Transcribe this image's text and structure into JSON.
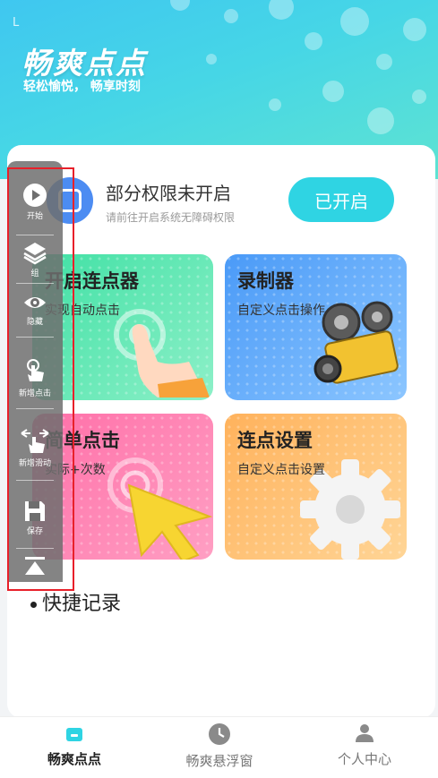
{
  "header": {
    "status_letter": "L",
    "app_title": "畅爽点点",
    "app_subtitle": "轻松愉悦， 畅享时刻"
  },
  "permission": {
    "title": "部分权限未开启",
    "subtitle": "请前往开启系统无障碍权限",
    "button_label": "已开启"
  },
  "features": [
    {
      "title": "开启连点器",
      "subtitle": "实现自动点击"
    },
    {
      "title": "录制器",
      "subtitle": "自定义点击操作"
    },
    {
      "title": "简单点击",
      "subtitle": "实际+次数"
    },
    {
      "title": "连点设置",
      "subtitle": "自定义点击设置"
    }
  ],
  "quick_record_label": "快捷记录",
  "float_panel": {
    "items": [
      {
        "label": "开始",
        "icon": "play-icon"
      },
      {
        "label": "组",
        "icon": "layers-icon"
      },
      {
        "label": "隐藏",
        "icon": "eye-icon"
      },
      {
        "label": "新增点击",
        "icon": "tap-icon"
      },
      {
        "label": "新增滑动",
        "icon": "swipe-icon"
      },
      {
        "label": "保存",
        "icon": "save-icon"
      },
      {
        "label": "",
        "icon": "collapse-icon"
      }
    ]
  },
  "tabbar": {
    "tabs": [
      {
        "label": "畅爽点点",
        "icon": "home-icon",
        "active": true
      },
      {
        "label": "畅爽悬浮窗",
        "icon": "clock-icon",
        "active": false
      },
      {
        "label": "个人中心",
        "icon": "person-icon",
        "active": false
      }
    ]
  },
  "colors": {
    "accent": "#2fd4e3",
    "highlight_box": "#e8202a"
  }
}
